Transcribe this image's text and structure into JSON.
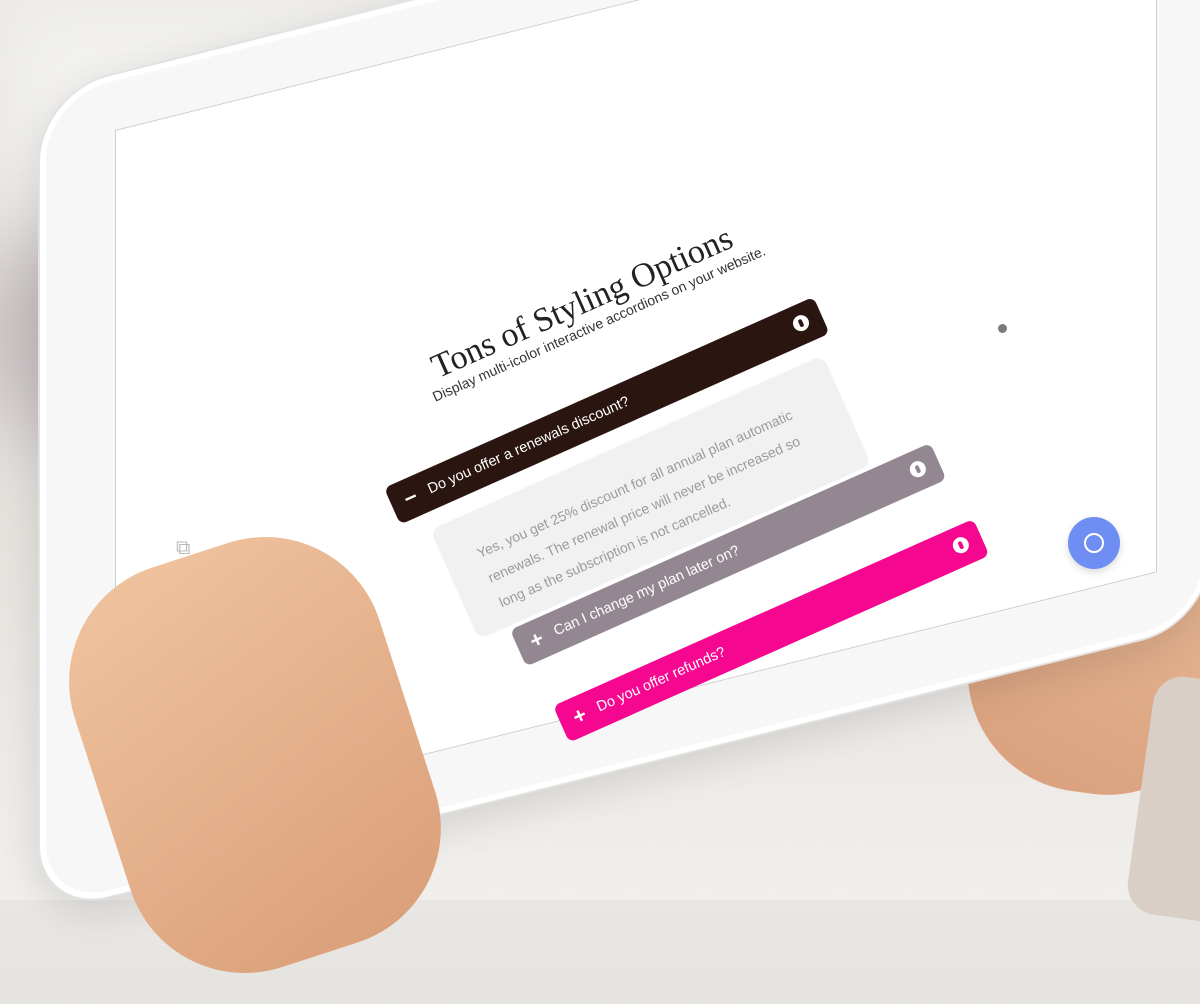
{
  "page": {
    "title": "Tons of Styling Options",
    "subtitle": "Display multi-icolor interactive accordions on your website."
  },
  "accordion": [
    {
      "question": "Do you offer a renewals discount?",
      "state": "open",
      "toggle_symbol": "−",
      "color": "#2a1510",
      "answer": "Yes, you get 25% discount for all annual plan automatic renewals. The renewal price will never be increased so long as the subscription is not cancelled."
    },
    {
      "question": "Can I change my plan later on?",
      "state": "collapsed",
      "toggle_symbol": "+",
      "color": "#938892"
    },
    {
      "question": "Do you offer refunds?",
      "state": "collapsed",
      "toggle_symbol": "+",
      "color": "#f5078f"
    }
  ],
  "chat_widget": {
    "icon": "chat-bubble-icon",
    "color": "#6f8ef3"
  }
}
